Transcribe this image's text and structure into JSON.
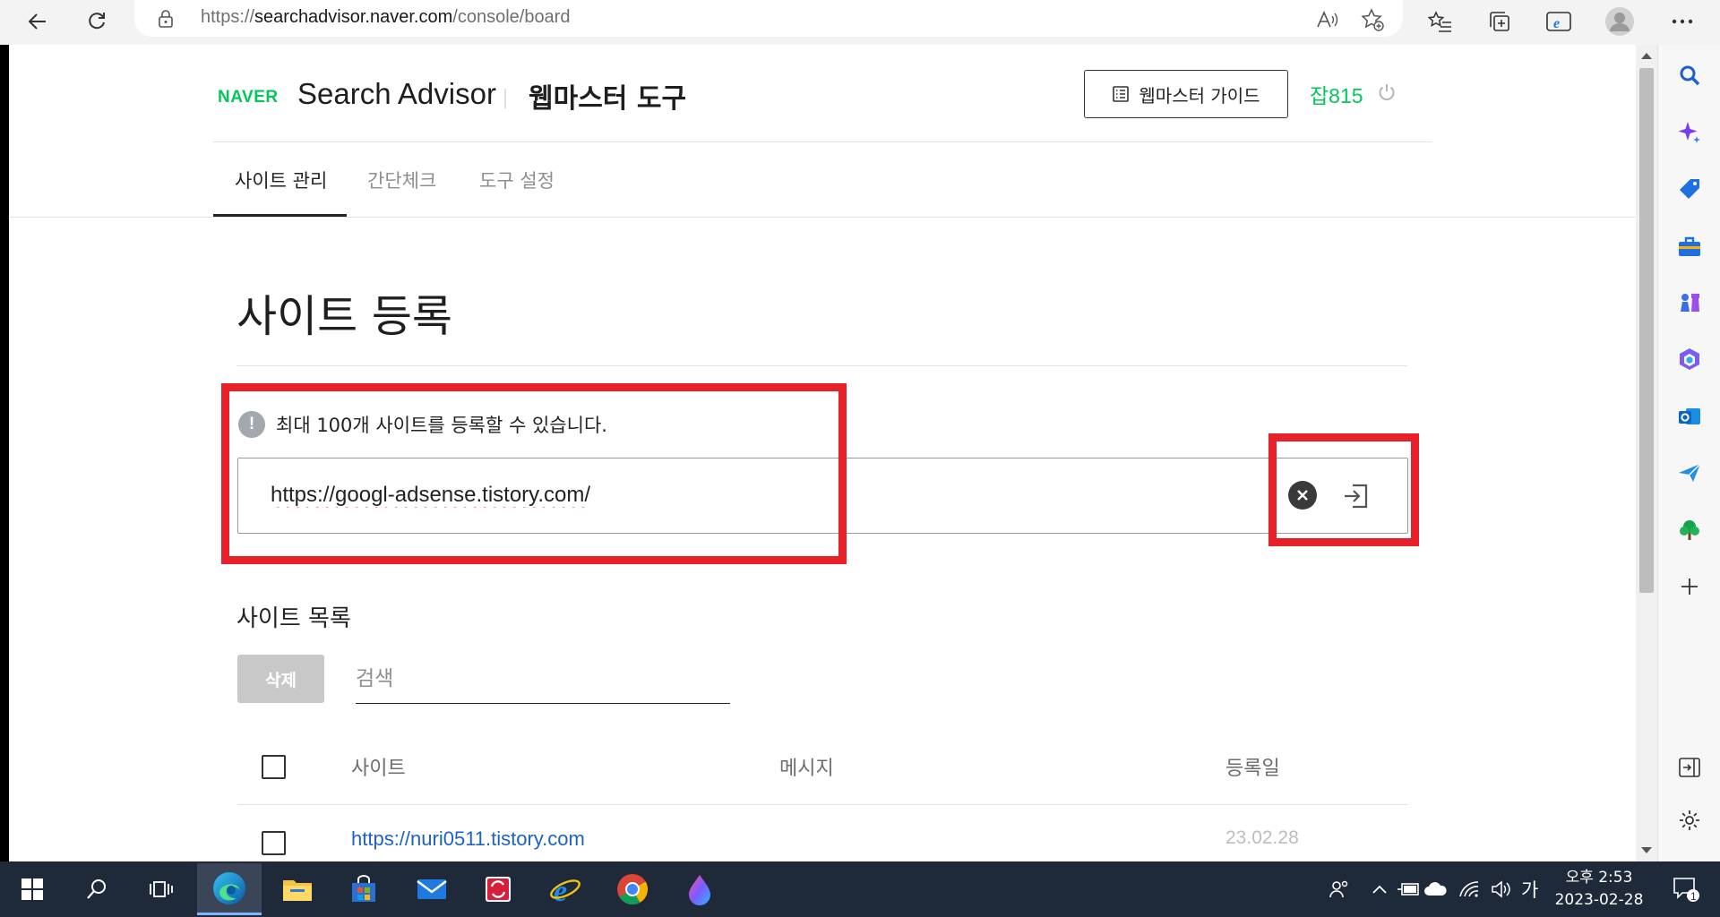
{
  "browser": {
    "url_scheme": "https://",
    "url_host": "searchadvisor.naver.com",
    "url_path": "/console/board"
  },
  "header": {
    "naver_logo": "NAVER",
    "product_name": "Search Advisor",
    "section_title": "웹마스터 도구",
    "guide_button": "웹마스터 가이드",
    "username": "잡815"
  },
  "tabs": [
    {
      "label": "사이트 관리",
      "active": true
    },
    {
      "label": "간단체크",
      "active": false
    },
    {
      "label": "도구 설정",
      "active": false
    }
  ],
  "main": {
    "title": "사이트 등록",
    "notice": "최대 100개 사이트를 등록할 수 있습니다.",
    "site_input_value": "https://googl-adsense.tistory.com/",
    "list_title": "사이트 목록",
    "delete_button": "삭제",
    "search_placeholder": "검색"
  },
  "table": {
    "columns": [
      "사이트",
      "메시지",
      "등록일"
    ],
    "rows": [
      {
        "site": "https://nuri0511.tistory.com",
        "message": "",
        "date": "23.02.28"
      }
    ]
  },
  "taskbar": {
    "time": "오후 2:53",
    "date": "2023-02-28",
    "ime": "가",
    "notification_count": "1"
  },
  "colors": {
    "naver_green": "#03c75a",
    "link_blue": "#1d62c6",
    "highlight_red": "#e8202a"
  }
}
